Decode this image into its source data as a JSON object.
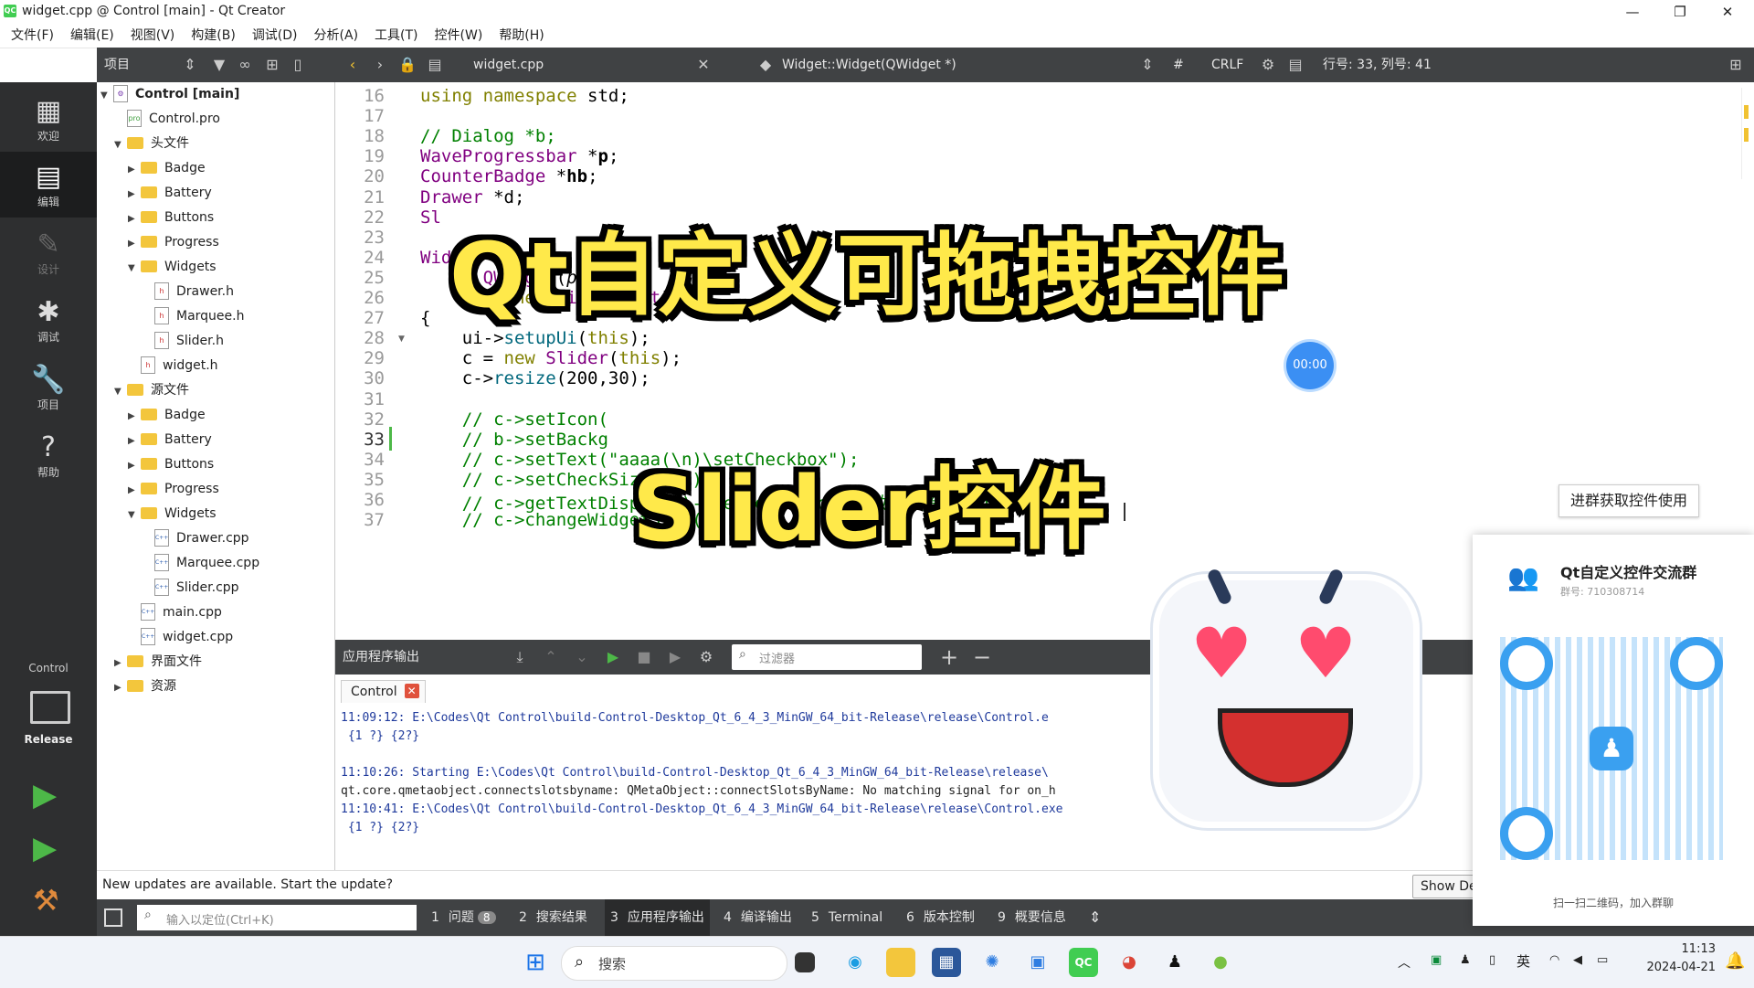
{
  "window": {
    "title": "widget.cpp @ Control [main] - Qt Creator",
    "app_icon": "qt-icon",
    "minimize": "—",
    "maximize": "❐",
    "close": "✕"
  },
  "menu": [
    "文件(F)",
    "编辑(E)",
    "视图(V)",
    "构建(B)",
    "调试(D)",
    "分析(A)",
    "工具(T)",
    "控件(W)",
    "帮助(H)"
  ],
  "toolbar": {
    "project_label": "项目",
    "file_name": "widget.cpp",
    "symbol": "Widget::Widget(QWidget *)",
    "hash": "#",
    "line_ending": "CRLF",
    "cursor_pos": "行号: 33, 列号: 41"
  },
  "modes": [
    {
      "label": "欢迎",
      "icon": "grid-icon"
    },
    {
      "label": "编辑",
      "icon": "edit-icon"
    },
    {
      "label": "设计",
      "icon": "pencil-icon"
    },
    {
      "label": "调试",
      "icon": "bug-icon"
    },
    {
      "label": "项目",
      "icon": "wrench-icon"
    },
    {
      "label": "帮助",
      "icon": "help-icon"
    }
  ],
  "kit": {
    "name": "Control",
    "config": "Release"
  },
  "tree": [
    {
      "text": "Control [main]",
      "depth": 0,
      "type": "project",
      "arrow": "▼"
    },
    {
      "text": "Control.pro",
      "depth": 1,
      "type": "pro",
      "arrow": ""
    },
    {
      "text": "头文件",
      "depth": 1,
      "type": "folder",
      "arrow": "▼"
    },
    {
      "text": "Badge",
      "depth": 2,
      "type": "folder",
      "arrow": "▶"
    },
    {
      "text": "Battery",
      "depth": 2,
      "type": "folder",
      "arrow": "▶"
    },
    {
      "text": "Buttons",
      "depth": 2,
      "type": "folder",
      "arrow": "▶"
    },
    {
      "text": "Progress",
      "depth": 2,
      "type": "folder",
      "arrow": "▶"
    },
    {
      "text": "Widgets",
      "depth": 2,
      "type": "folder",
      "arrow": "▼"
    },
    {
      "text": "Drawer.h",
      "depth": 3,
      "type": "h",
      "arrow": ""
    },
    {
      "text": "Marquee.h",
      "depth": 3,
      "type": "h",
      "arrow": ""
    },
    {
      "text": "Slider.h",
      "depth": 3,
      "type": "h",
      "arrow": ""
    },
    {
      "text": "widget.h",
      "depth": 2,
      "type": "h",
      "arrow": ""
    },
    {
      "text": "源文件",
      "depth": 1,
      "type": "folder",
      "arrow": "▼"
    },
    {
      "text": "Badge",
      "depth": 2,
      "type": "folder",
      "arrow": "▶"
    },
    {
      "text": "Battery",
      "depth": 2,
      "type": "folder",
      "arrow": "▶"
    },
    {
      "text": "Buttons",
      "depth": 2,
      "type": "folder",
      "arrow": "▶"
    },
    {
      "text": "Progress",
      "depth": 2,
      "type": "folder",
      "arrow": "▶"
    },
    {
      "text": "Widgets",
      "depth": 2,
      "type": "folder",
      "arrow": "▼"
    },
    {
      "text": "Drawer.cpp",
      "depth": 3,
      "type": "cpp",
      "arrow": ""
    },
    {
      "text": "Marquee.cpp",
      "depth": 3,
      "type": "cpp",
      "arrow": ""
    },
    {
      "text": "Slider.cpp",
      "depth": 3,
      "type": "cpp",
      "arrow": ""
    },
    {
      "text": "main.cpp",
      "depth": 2,
      "type": "cpp",
      "arrow": ""
    },
    {
      "text": "widget.cpp",
      "depth": 2,
      "type": "cpp",
      "arrow": ""
    },
    {
      "text": "界面文件",
      "depth": 1,
      "type": "folder",
      "arrow": "▶"
    },
    {
      "text": "资源",
      "depth": 1,
      "type": "folder",
      "arrow": "▶"
    }
  ],
  "code_lines": [
    {
      "n": "16",
      "html": "<span class=\"kw\">using</span> <span class=\"kw\">namespace</span> std;"
    },
    {
      "n": "17",
      "html": ""
    },
    {
      "n": "18",
      "html": "<span class=\"cm\">// Dialog *b;</span>"
    },
    {
      "n": "19",
      "html": "<span class=\"ty\">WaveProgressbar</span> *<b>p</b>;"
    },
    {
      "n": "20",
      "html": "<span class=\"ty\">CounterBadge</span> *<b>hb</b>;"
    },
    {
      "n": "21",
      "html": "<span class=\"ty\">Drawer</span> *d;"
    },
    {
      "n": "22",
      "html": "<span class=\"ty\">Sl</span>"
    },
    {
      "n": "23",
      "html": ""
    },
    {
      "n": "24",
      "html": "<span class=\"ty\">Wid</span>"
    },
    {
      "n": "25",
      "html": "    : <span class=\"ty\">QWidget</span>(<i>parent</i>)"
    },
    {
      "n": "26",
      "html": "    , ui(<span class=\"kw\">new</span> <span class=\"ty\">Ui::Widget</span>)"
    },
    {
      "n": "27",
      "html": "{"
    },
    {
      "n": "28",
      "html": "    ui-><span class=\"fn\">setupUi</span>(<span class=\"kw\">this</span>);"
    },
    {
      "n": "29",
      "html": "    c = <span class=\"kw\">new</span> <span class=\"ty\">Slider</span>(<span class=\"kw\">this</span>);"
    },
    {
      "n": "30",
      "html": "    c-><span class=\"fn\">resize</span>(200,30);"
    },
    {
      "n": "31",
      "html": ""
    },
    {
      "n": "32",
      "html": "    <span class=\"cm\">// c->setIcon(</span>"
    },
    {
      "n": "33",
      "html": "    <span class=\"cm\">// b->setBackg</span>"
    },
    {
      "n": "34",
      "html": "    <span class=\"cm\">// c->setText(\"aaaa(\\n)\\setCheckbox\");</span>"
    },
    {
      "n": "35",
      "html": "    <span class=\"cm\">// c->setCheckSize(200);</span>"
    },
    {
      "n": "36",
      "html": "    <span class=\"cm\">// c->getTextDisplay()->setFont(QFont(\"微软雅黑\",15));</span>"
    },
    {
      "n": "37",
      "html": "    <span class=\"cm\">// c->changeWidgetSize();</span>"
    }
  ],
  "output": {
    "title": "应用程序输出",
    "filter_placeholder": "过滤器",
    "tab": "Control",
    "lines": [
      {
        "cls": "blue",
        "text": "11:09:12: E:\\Codes\\Qt Control\\build-Control-Desktop_Qt_6_4_3_MinGW_64_bit-Release\\release\\Control.e"
      },
      {
        "cls": "blue",
        "text": " {1 ?} {2?}"
      },
      {
        "cls": "",
        "text": ""
      },
      {
        "cls": "blue",
        "text": "11:10:26: Starting E:\\Codes\\Qt Control\\build-Control-Desktop_Qt_6_4_3_MinGW_64_bit-Release\\release\\"
      },
      {
        "cls": "",
        "text": "qt.core.qmetaobject.connectslotsbyname: QMetaObject::connectSlotsByName: No matching signal for on_h                                   d(int)"
      },
      {
        "cls": "blue",
        "text": "11:10:41: E:\\Codes\\Qt Control\\build-Control-Desktop_Qt_6_4_3_MinGW_64_bit-Release\\release\\Control.exe"
      },
      {
        "cls": "blue",
        "text": " {1 ?} {2?}"
      }
    ]
  },
  "notification": {
    "text": "New updates are available. Start the update?",
    "button": "Show De"
  },
  "statusbar": {
    "locate_placeholder": "输入以定位(Ctrl+K)",
    "tabs": [
      {
        "num": "1",
        "label": "问题",
        "badge": "8"
      },
      {
        "num": "2",
        "label": "搜索结果",
        "badge": ""
      },
      {
        "num": "3",
        "label": "应用程序输出",
        "badge": ""
      },
      {
        "num": "4",
        "label": "编译输出",
        "badge": ""
      },
      {
        "num": "5",
        "label": "Terminal",
        "badge": ""
      },
      {
        "num": "6",
        "label": "版本控制",
        "badge": ""
      },
      {
        "num": "9",
        "label": "概要信息",
        "badge": ""
      }
    ]
  },
  "taskbar": {
    "search_placeholder": "搜索",
    "ime": "英",
    "time": "11:13",
    "date": "2024-04-21"
  },
  "overlay": {
    "headline": "Qt自定义可拖拽控件",
    "subheadline": "Slider控件",
    "timer": "00:00",
    "join_button": "进群获取控件使用",
    "group_name": "Qt自定义控件交流群",
    "group_id": "群号: 710308714",
    "qr_caption": "扫一扫二维码，加入群聊"
  },
  "colors": {
    "accent_yellow": "#ffe94a",
    "qt_green": "#41cd52",
    "dark_bar": "#404244",
    "qr_blue": "#3aa0f0"
  }
}
